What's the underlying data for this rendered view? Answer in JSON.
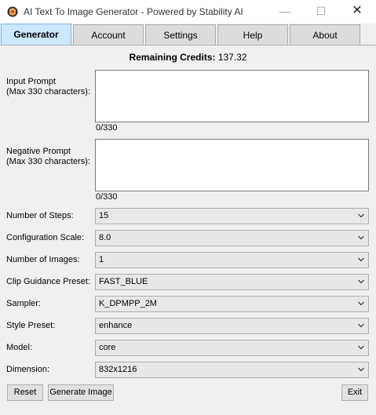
{
  "window": {
    "title": "AI Text To Image Generator - Powered by Stability AI",
    "min_glyph": "—",
    "max_glyph": "☐",
    "close_glyph": "✕"
  },
  "tabs": [
    {
      "label": "Generator",
      "active": true
    },
    {
      "label": "Account"
    },
    {
      "label": "Settings"
    },
    {
      "label": "Help"
    },
    {
      "label": "About"
    }
  ],
  "credits": {
    "label": "Remaining Credits:",
    "value": "137.32"
  },
  "input_prompt": {
    "label_line1": "Input Prompt",
    "label_line2": "(Max 330 characters):",
    "value": "",
    "counter": "0/330"
  },
  "negative_prompt": {
    "label_line1": "Negative Prompt",
    "label_line2": "(Max 330 characters):",
    "value": "",
    "counter": "0/330"
  },
  "fields": {
    "steps": {
      "label": "Number of Steps:",
      "value": "15"
    },
    "cfg_scale": {
      "label": "Configuration Scale:",
      "value": "8.0"
    },
    "images": {
      "label": "Number of Images:",
      "value": "1"
    },
    "clip_guidance": {
      "label": "Clip Guidance Preset:",
      "value": "FAST_BLUE"
    },
    "sampler": {
      "label": "Sampler:",
      "value": "K_DPMPP_2M"
    },
    "style_preset": {
      "label": "Style Preset:",
      "value": "enhance"
    },
    "model": {
      "label": "Model:",
      "value": "core"
    },
    "dimension": {
      "label": "Dimension:",
      "value": "832x1216"
    }
  },
  "buttons": {
    "reset": "Reset",
    "generate": "Generate Image",
    "exit": "Exit"
  },
  "colors": {
    "active_tab": "#cce8ff",
    "window_bg": "#f0f0f0"
  }
}
